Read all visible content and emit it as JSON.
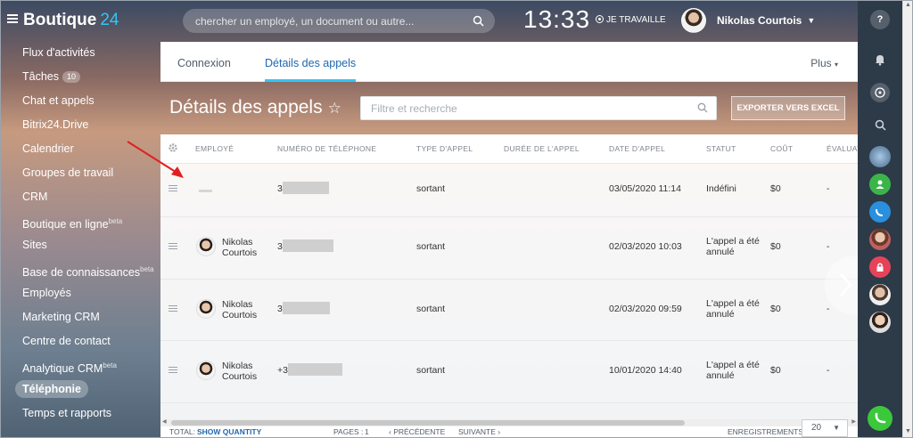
{
  "header": {
    "brand_name": "Boutique",
    "brand_num": "24",
    "search_placeholder": "chercher un employé, un document ou autre...",
    "clock": "13:33",
    "work_status": "JE TRAVAILLE",
    "user_name": "Nikolas Courtois"
  },
  "sidebar": {
    "items": [
      {
        "label": "Flux d'activités"
      },
      {
        "label": "Tâches",
        "badge": "10"
      },
      {
        "label": "Chat et appels"
      },
      {
        "label": "Bitrix24.Drive"
      },
      {
        "label": "Calendrier"
      },
      {
        "label": "Groupes de travail"
      },
      {
        "label": "CRM"
      },
      {
        "label": "Boutique en ligne",
        "sup": "beta"
      },
      {
        "label": "Sites"
      },
      {
        "label": "Base de connaissances",
        "sup": "beta"
      },
      {
        "label": "Employés"
      },
      {
        "label": "Marketing CRM"
      },
      {
        "label": "Centre de contact"
      },
      {
        "label": "Analytique CRM",
        "sup": "beta"
      },
      {
        "label": "Téléphonie"
      },
      {
        "label": "Temps et rapports"
      }
    ]
  },
  "tabs": [
    {
      "label": "Connexion"
    },
    {
      "label": "Détails des appels"
    }
  ],
  "more_label": "Plus",
  "page": {
    "title": "Détails des appels",
    "filter_placeholder": "Filtre et recherche",
    "export_label": "EXPORTER VERS EXCEL"
  },
  "grid": {
    "columns": [
      "EMPLOYÉ",
      "NUMÉRO DE TÉLÉPHONE",
      "TYPE D'APPEL",
      "DURÉE DE L'APPEL",
      "DATE D'APPEL",
      "STATUT",
      "COÛT",
      "ÉVALUATI"
    ],
    "rows": [
      {
        "employee": "",
        "phone": "3",
        "type": "sortant",
        "duration": "",
        "date": "03/05/2020 11:14",
        "status": "Indéfini",
        "cost": "$0",
        "rating": "-"
      },
      {
        "employee": "Nikolas Courtois",
        "phone": "3",
        "type": "sortant",
        "duration": "",
        "date": "02/03/2020 10:03",
        "status": "L'appel a été annulé",
        "cost": "$0",
        "rating": "-"
      },
      {
        "employee": "Nikolas Courtois",
        "phone": "3",
        "type": "sortant",
        "duration": "",
        "date": "02/03/2020 09:59",
        "status": "L'appel a été annulé",
        "cost": "$0",
        "rating": "-"
      },
      {
        "employee": "Nikolas Courtois",
        "phone": "+3",
        "type": "sortant",
        "duration": "",
        "date": "10/01/2020 14:40",
        "status": "L'appel a été annulé",
        "cost": "$0",
        "rating": "-"
      }
    ]
  },
  "footer": {
    "total_label": "TOTAL:",
    "show_quantity": "SHOW QUANTITY",
    "pages_label": "PAGES :",
    "page_num": "1",
    "prev": "PRÉCÉDENTE",
    "next": "SUIVANTE",
    "records_label": "ENREGISTREMENTS :",
    "records_value": "20"
  },
  "colors": {
    "accent": "#2fc6f6",
    "link": "#2067b0",
    "rightbar": "#2d3a48"
  },
  "rightbar_icons": [
    "help-icon",
    "bell-icon",
    "chat-icon",
    "search-icon",
    "user-icon",
    "phone-icon",
    "lock-icon",
    "call-icon"
  ]
}
